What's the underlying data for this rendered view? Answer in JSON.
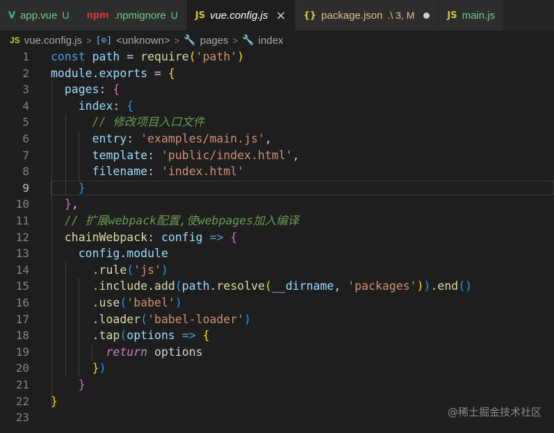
{
  "tabs": [
    {
      "icon": "V",
      "icon_name": "vue-icon",
      "name": "app.vue",
      "badge": "U"
    },
    {
      "icon": "npm",
      "icon_name": "npm-icon",
      "name": ".npmignore",
      "badge": "U"
    },
    {
      "icon": "JS",
      "icon_name": "js-icon",
      "name": "vue.config.js",
      "close": "×",
      "active": true
    },
    {
      "icon": "{}",
      "icon_name": "json-icon",
      "name": "package.json",
      "badge": ".\\ 3, M",
      "dirty": true
    },
    {
      "icon": "JS",
      "icon_name": "js-icon",
      "name": "main.js"
    }
  ],
  "breadcrumb": {
    "file_icon": "JS",
    "file": "vue.config.js",
    "sep": ">",
    "symbol_icon": "[⊙]",
    "unknown": "<unknown>",
    "wrench": "🔧",
    "pages": "pages",
    "index": "index"
  },
  "editor": {
    "current_line": 9,
    "lines": [
      {
        "n": "1",
        "t": [
          [
            "k",
            "const "
          ],
          [
            "v",
            "path"
          ],
          [
            "p",
            " = "
          ],
          [
            "f",
            "require"
          ],
          [
            "b1",
            "("
          ],
          [
            "s",
            "'path'"
          ],
          [
            "b1",
            ")"
          ]
        ]
      },
      {
        "n": "2",
        "t": [
          [
            "v",
            "module"
          ],
          [
            "p",
            "."
          ],
          [
            "v",
            "exports"
          ],
          [
            "p",
            " = "
          ],
          [
            "b1",
            "{"
          ]
        ]
      },
      {
        "n": "3",
        "t": [
          [
            "p",
            "  "
          ],
          [
            "v",
            "pages"
          ],
          [
            "p",
            ": "
          ],
          [
            "b2",
            "{"
          ]
        ]
      },
      {
        "n": "4",
        "t": [
          [
            "p",
            "    "
          ],
          [
            "v",
            "index"
          ],
          [
            "p",
            ": "
          ],
          [
            "b3",
            "{"
          ]
        ]
      },
      {
        "n": "5",
        "t": [
          [
            "p",
            "      "
          ],
          [
            "c",
            "// 修改项目入口文件"
          ]
        ]
      },
      {
        "n": "6",
        "t": [
          [
            "p",
            "      "
          ],
          [
            "v",
            "entry"
          ],
          [
            "p",
            ": "
          ],
          [
            "s",
            "'examples/main.js'"
          ],
          [
            "p",
            ","
          ]
        ]
      },
      {
        "n": "7",
        "t": [
          [
            "p",
            "      "
          ],
          [
            "v",
            "template"
          ],
          [
            "p",
            ": "
          ],
          [
            "s",
            "'public/index.html'"
          ],
          [
            "p",
            ","
          ]
        ]
      },
      {
        "n": "8",
        "t": [
          [
            "p",
            "      "
          ],
          [
            "v",
            "filename"
          ],
          [
            "p",
            ": "
          ],
          [
            "s",
            "'index.html'"
          ]
        ]
      },
      {
        "n": "9",
        "t": [
          [
            "p",
            "    "
          ],
          [
            "b3",
            "}"
          ]
        ]
      },
      {
        "n": "10",
        "t": [
          [
            "p",
            "  "
          ],
          [
            "b2",
            "}"
          ],
          [
            "p",
            ","
          ]
        ]
      },
      {
        "n": "11",
        "t": [
          [
            "p",
            "  "
          ],
          [
            "c",
            "// 扩展webpack配置,使webpages加入编译"
          ]
        ]
      },
      {
        "n": "12",
        "t": [
          [
            "p",
            "  "
          ],
          [
            "f",
            "chainWebpack"
          ],
          [
            "p",
            ": "
          ],
          [
            "v",
            "config"
          ],
          [
            "p",
            " "
          ],
          [
            "k",
            "=>"
          ],
          [
            "p",
            " "
          ],
          [
            "b2",
            "{"
          ]
        ]
      },
      {
        "n": "13",
        "t": [
          [
            "p",
            "    "
          ],
          [
            "v",
            "config"
          ],
          [
            "p",
            "."
          ],
          [
            "v",
            "module"
          ]
        ]
      },
      {
        "n": "14",
        "t": [
          [
            "p",
            "      ."
          ],
          [
            "f",
            "rule"
          ],
          [
            "b3",
            "("
          ],
          [
            "s",
            "'js'"
          ],
          [
            "b3",
            ")"
          ]
        ]
      },
      {
        "n": "15",
        "t": [
          [
            "p",
            "      ."
          ],
          [
            "f",
            "include"
          ],
          [
            "p",
            "."
          ],
          [
            "f",
            "add"
          ],
          [
            "b3",
            "("
          ],
          [
            "v",
            "path"
          ],
          [
            "p",
            "."
          ],
          [
            "f",
            "resolve"
          ],
          [
            "b1",
            "("
          ],
          [
            "v",
            "__dirname"
          ],
          [
            "p",
            ", "
          ],
          [
            "s",
            "'packages'"
          ],
          [
            "b1",
            ")"
          ],
          [
            "b3",
            ")"
          ],
          [
            "p",
            "."
          ],
          [
            "f",
            "end"
          ],
          [
            "b3",
            "()"
          ]
        ]
      },
      {
        "n": "16",
        "t": [
          [
            "p",
            "      ."
          ],
          [
            "f",
            "use"
          ],
          [
            "b3",
            "("
          ],
          [
            "s",
            "'babel'"
          ],
          [
            "b3",
            ")"
          ]
        ]
      },
      {
        "n": "17",
        "t": [
          [
            "p",
            "      ."
          ],
          [
            "f",
            "loader"
          ],
          [
            "b3",
            "("
          ],
          [
            "s",
            "'babel-loader'"
          ],
          [
            "b3",
            ")"
          ]
        ]
      },
      {
        "n": "18",
        "t": [
          [
            "p",
            "      ."
          ],
          [
            "f",
            "tap"
          ],
          [
            "b3",
            "("
          ],
          [
            "v",
            "options"
          ],
          [
            "p",
            " "
          ],
          [
            "k",
            "=>"
          ],
          [
            "p",
            " "
          ],
          [
            "b1",
            "{"
          ]
        ]
      },
      {
        "n": "19",
        "t": [
          [
            "p",
            "        "
          ],
          [
            "kw",
            "return"
          ],
          [
            "p",
            " options"
          ]
        ]
      },
      {
        "n": "20",
        "t": [
          [
            "p",
            "      "
          ],
          [
            "b1",
            "}"
          ],
          [
            "b3",
            ")"
          ]
        ]
      },
      {
        "n": "21",
        "t": [
          [
            "p",
            "    "
          ],
          [
            "b2",
            "}"
          ]
        ]
      },
      {
        "n": "22",
        "t": [
          [
            "b1",
            "}"
          ]
        ]
      },
      {
        "n": "23",
        "t": []
      }
    ]
  },
  "watermark": "@稀土掘金技术社区"
}
